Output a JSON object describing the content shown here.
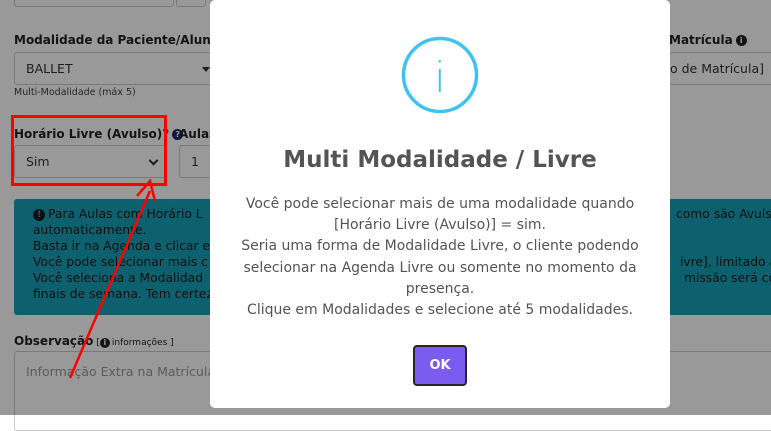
{
  "form": {
    "modalidade_label": "Modalidade da Paciente/Aluno(a)",
    "modalidade_value": "BALLET",
    "multi_hint": "Multi-Modalidade (máx 5)",
    "matricula_label": "Matrícula",
    "matricula_value": "o de Matrícula]",
    "horario_label": "Horário Livre (Avulso)?",
    "horario_help": "?",
    "horario_value": "Sim",
    "aulas_label": "Aulas",
    "aulas_value": "1",
    "observacao_label": "Observação",
    "observacao_info": "informações ]",
    "observacao_placeholder": "Informação Extra na Matrícula"
  },
  "alert": {
    "line1": "Para Aulas com Horário L",
    "line1_right": "como são Avulsa",
    "line2": "automaticamente.",
    "line3": "Basta ir na Agenda e clicar e",
    "line4": "Você pode selecionar mais c",
    "line4_right": "ivre], limitado at",
    "line5": "Você seleciona a Modalidad",
    "line5_right": "missão será con",
    "line6": "finais de semana. Tem certez"
  },
  "modal": {
    "icon_glyph": "i",
    "title": "Multi Modalidade / Livre",
    "body_lines": [
      "Você pode selecionar mais de uma modalidade quando",
      "[Horário Livre (Avulso)] = sim.",
      "Seria uma forma de Modalidade Livre, o cliente podendo",
      "selecionar na Agenda Livre ou somente no momento da",
      "presença.",
      "Clique em Modalidades e selecione até 5 modalidades."
    ],
    "ok_label": "OK"
  },
  "colors": {
    "alert_bg": "#17a2b8",
    "ok_button": "#7c5cf0",
    "info_icon": "#3fc3ee",
    "annotation": "#ff0000"
  }
}
